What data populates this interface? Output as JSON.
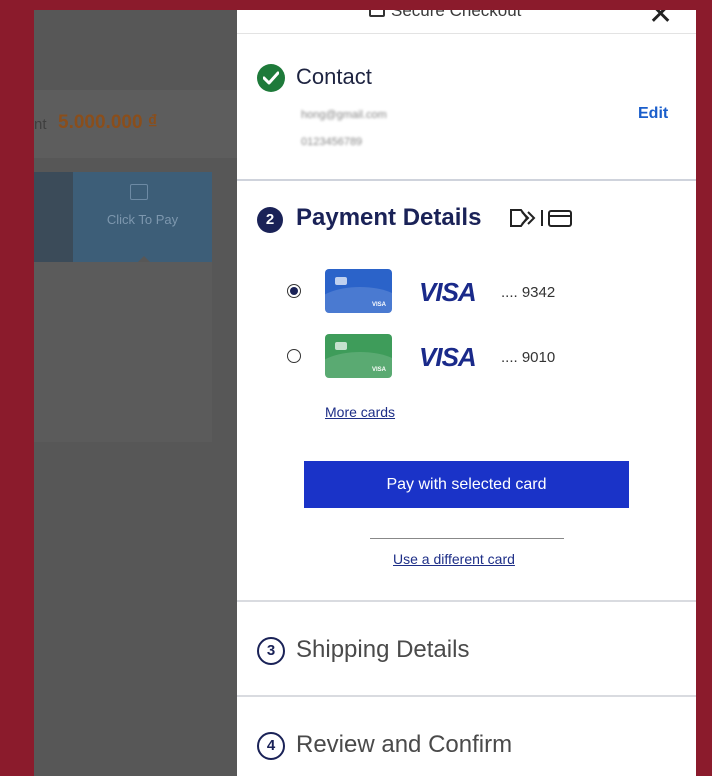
{
  "background": {
    "amount_prefix": "nt",
    "amount": "5.000.000 ₫",
    "tab_label": "Click To Pay"
  },
  "header": {
    "title": "Secure Checkout"
  },
  "contact": {
    "title": "Contact",
    "email": "hong@gmail.com",
    "phone": "0123456789",
    "edit_label": "Edit"
  },
  "payment": {
    "step": "2",
    "title": "Payment Details",
    "cards": [
      {
        "brand": "VISA",
        "digits": ".... 9342",
        "selected": true,
        "color": "#2b63c9"
      },
      {
        "brand": "VISA",
        "digits": ".... 9010",
        "selected": false,
        "color": "#3e9c5a"
      }
    ],
    "more_cards": "More cards",
    "pay_button": "Pay with selected card",
    "different_card": "Use a different card"
  },
  "steps": [
    {
      "number": "3",
      "title": "Shipping Details"
    },
    {
      "number": "4",
      "title": "Review and Confirm"
    }
  ],
  "colors": {
    "frame": "#8b1b2c",
    "accent": "#1a33c8",
    "navy": "#1a2257",
    "success": "#1e7a3a"
  }
}
